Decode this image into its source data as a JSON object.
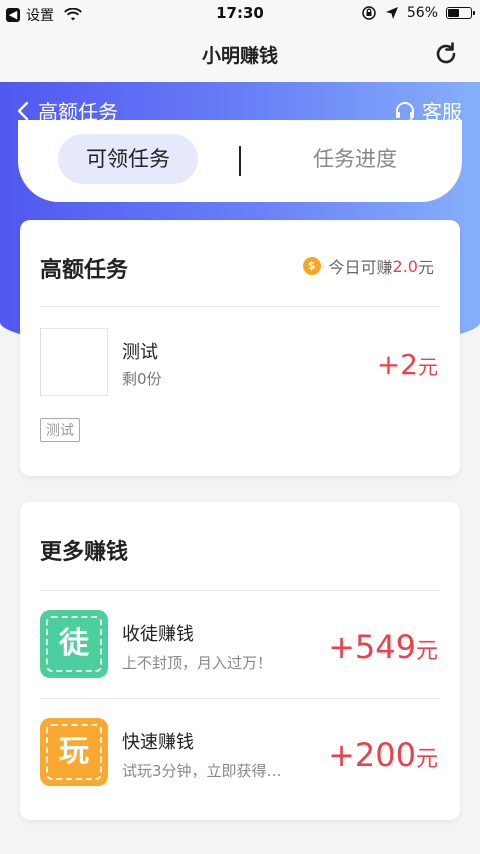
{
  "status_bar": {
    "back_app_label": "设置",
    "time": "17:30",
    "battery_percent": "56%",
    "battery_level": 0.56
  },
  "nav": {
    "title": "小明赚钱"
  },
  "subheader": {
    "back_label": "高额任务",
    "service_label": "客服"
  },
  "tabs": {
    "active": "可领任务",
    "inactive": "任务进度"
  },
  "high_card": {
    "title": "高额任务",
    "earn_prefix": "今日可赚",
    "earn_amount": "2.0",
    "earn_unit": "元",
    "coin_symbol": "$",
    "task": {
      "name": "测试",
      "remaining": "剩0份",
      "reward": "+2",
      "reward_unit": "元",
      "tag": "测试"
    }
  },
  "more_card": {
    "title": "更多赚钱",
    "items": [
      {
        "icon_char": "徒",
        "icon_color": "#4ccf9c",
        "name": "收徒赚钱",
        "desc": "上不封顶，月入过万！",
        "reward": "+549",
        "unit": "元"
      },
      {
        "icon_char": "玩",
        "icon_color": "#f9a931",
        "name": "快速赚钱",
        "desc": "试玩3分钟，立即获得…",
        "reward": "+200",
        "unit": "元"
      }
    ]
  },
  "colors": {
    "accent_red": "#e8434a",
    "hero_start": "#5058f0",
    "hero_end": "#86b0fb"
  }
}
